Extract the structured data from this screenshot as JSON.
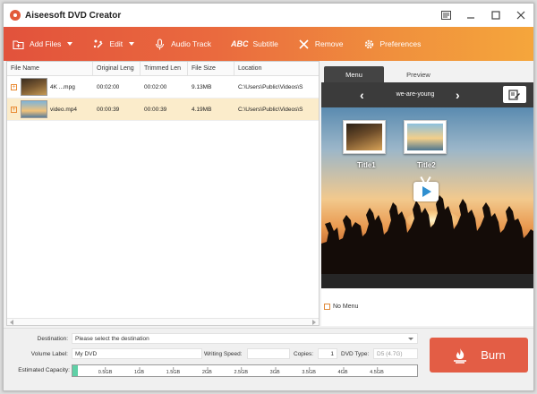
{
  "window": {
    "title": "Aiseesoft DVD Creator"
  },
  "toolbar": {
    "add_files": "Add Files",
    "edit": "Edit",
    "audio_track": "Audio Track",
    "subtitle_abc": "ABC",
    "subtitle": "Subtitle",
    "remove": "Remove",
    "preferences": "Preferences"
  },
  "filelist": {
    "columns": [
      "File Name",
      "Original Leng",
      "Trimmed Len",
      "File Size",
      "Location"
    ],
    "rows": [
      {
        "name": "4K ...mpg",
        "original": "00:02:00",
        "trimmed": "00:02:00",
        "size": "9.13MB",
        "location": "C:\\Users\\Public\\Videos\\S"
      },
      {
        "name": "video.mp4",
        "original": "00:00:39",
        "trimmed": "00:00:39",
        "size": "4.19MB",
        "location": "C:\\Users\\Public\\Videos\\S"
      }
    ]
  },
  "panel": {
    "tabs": [
      "Menu",
      "Preview"
    ],
    "active_tab": "Menu",
    "menu_title": "we-are-young",
    "titles": [
      "Title1",
      "Title2"
    ],
    "no_menu": "No Menu"
  },
  "settings": {
    "destination_label": "Destination:",
    "destination_placeholder": "Please select the destination",
    "volume_label": "Volume Label:",
    "volume_value": "My DVD",
    "writing_speed_label": "Writing Speed:",
    "copies_label": "Copies:",
    "copies_value": "1",
    "dvd_type_label": "DVD Type:",
    "dvd_type_value": "D5 (4.7G)",
    "capacity_label": "Estimated Capacity:",
    "capacity_ticks": [
      "0.5GB",
      "1GB",
      "1.5GB",
      "2GB",
      "2.5GB",
      "3GB",
      "3.5GB",
      "4GB",
      "4.5GB"
    ],
    "capacity_used_fraction": 0.015
  },
  "burn": {
    "label": "Burn"
  },
  "colors": {
    "accent": "#e35d45",
    "selected_row": "#fbeccb",
    "capacity_fill": "#5fd0a6"
  }
}
